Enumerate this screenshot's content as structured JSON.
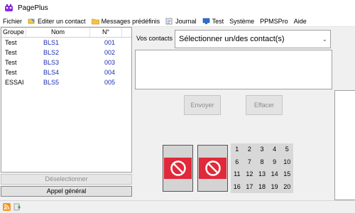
{
  "app": {
    "title": "PagePlus"
  },
  "menu": [
    {
      "label": "Fichier",
      "icon": ""
    },
    {
      "label": "Editer un contact",
      "icon": "edit-contact-icon"
    },
    {
      "label": "Messages prédéfinis",
      "icon": "folder-icon"
    },
    {
      "label": "Journal",
      "icon": "journal-icon"
    },
    {
      "label": "Test",
      "icon": "monitor-icon"
    },
    {
      "label": "Système",
      "icon": ""
    },
    {
      "label": "PPMSPro",
      "icon": ""
    },
    {
      "label": "Aide",
      "icon": ""
    }
  ],
  "contacts_table": {
    "headers": {
      "group": "Groupe",
      "name": "Nom",
      "number": "N°"
    },
    "rows": [
      {
        "group": "Test",
        "name": "BLS1",
        "number": "001"
      },
      {
        "group": "Test",
        "name": "BLS2",
        "number": "002"
      },
      {
        "group": "Test",
        "name": "BLS3",
        "number": "003"
      },
      {
        "group": "Test",
        "name": "BLS4",
        "number": "004"
      },
      {
        "group": "ESSAI",
        "name": "BLS5",
        "number": "005"
      }
    ]
  },
  "buttons": {
    "deselect": "Déselectionner",
    "appel_general": "Appel général",
    "envoyer": "Envoyer",
    "effacer": "Effacer"
  },
  "contacts_select": {
    "label": "Vos contacts :",
    "value": "Sélectionner un/des contact(s)"
  },
  "numpad": [
    "1",
    "2",
    "3",
    "4",
    "5",
    "6",
    "7",
    "8",
    "9",
    "10",
    "11",
    "12",
    "13",
    "14",
    "15",
    "16",
    "17",
    "18",
    "19",
    "20"
  ],
  "colors": {
    "blocked_red": "#e0293a",
    "link_blue": "#1a2db0"
  },
  "status_icons": [
    "rss-icon",
    "download-icon"
  ]
}
